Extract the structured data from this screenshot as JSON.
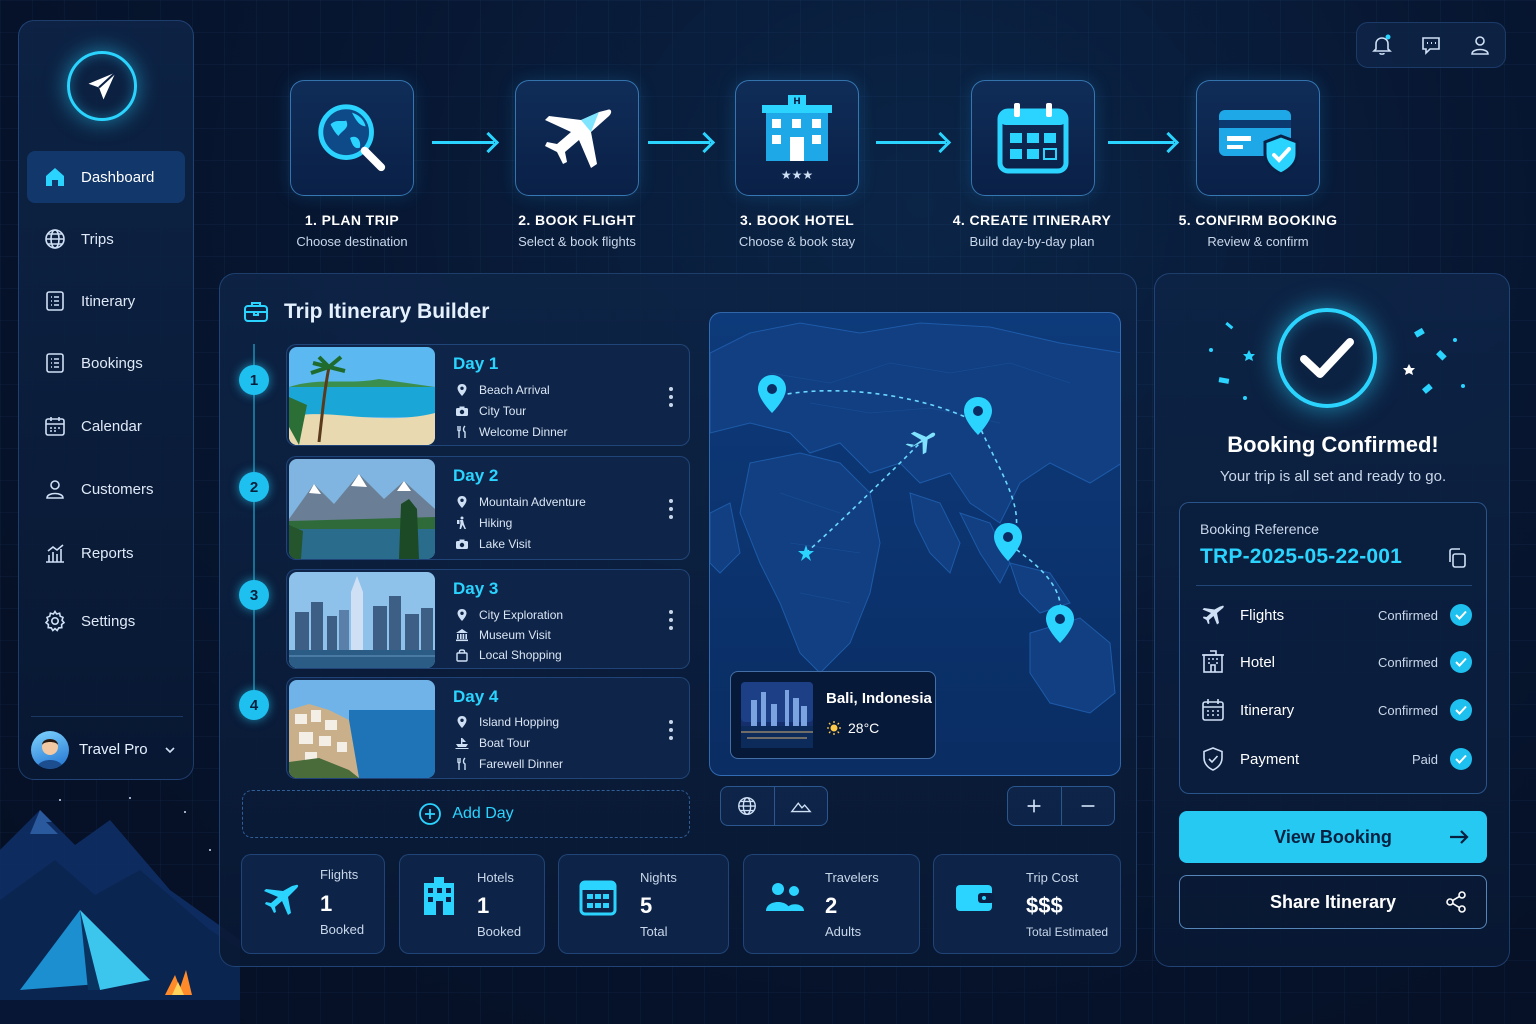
{
  "sidebar": {
    "items": [
      {
        "label": "Dashboard",
        "icon": "home-icon",
        "active": true
      },
      {
        "label": "Trips",
        "icon": "globe-icon"
      },
      {
        "label": "Itinerary",
        "icon": "list-icon"
      },
      {
        "label": "Bookings",
        "icon": "list-icon"
      },
      {
        "label": "Calendar",
        "icon": "calendar-icon"
      },
      {
        "label": "Customers",
        "icon": "user-icon"
      },
      {
        "label": "Reports",
        "icon": "chart-icon"
      },
      {
        "label": "Settings",
        "icon": "gear-icon"
      }
    ],
    "user": {
      "name": "Travel Pro"
    }
  },
  "header": {
    "icons": [
      "bell-icon",
      "chat-icon",
      "user-icon"
    ]
  },
  "steps": [
    {
      "title": "1. PLAN TRIP",
      "sub": "Choose destination",
      "icon": "globe-search-icon"
    },
    {
      "title": "2. BOOK FLIGHT",
      "sub": "Select & book flights",
      "icon": "airplane-icon"
    },
    {
      "title": "3. BOOK HOTEL",
      "sub": "Choose & book stay",
      "icon": "hotel-icon"
    },
    {
      "title": "4. CREATE ITINERARY",
      "sub": "Build day-by-day plan",
      "icon": "calendar-icon"
    },
    {
      "title": "5. CONFIRM BOOKING",
      "sub": "Review & confirm",
      "icon": "credit-card-shield-icon"
    }
  ],
  "builder": {
    "title": "Trip Itinerary Builder",
    "days": [
      {
        "num": "1",
        "title": "Day 1",
        "scene": "beach",
        "activities": [
          {
            "icon": "pin-icon",
            "text": "Beach Arrival"
          },
          {
            "icon": "camera-icon",
            "text": "City Tour"
          },
          {
            "icon": "utensils-icon",
            "text": "Welcome Dinner"
          }
        ]
      },
      {
        "num": "2",
        "title": "Day 2",
        "scene": "mountain",
        "activities": [
          {
            "icon": "pin-icon",
            "text": "Mountain Adventure"
          },
          {
            "icon": "hiking-icon",
            "text": "Hiking"
          },
          {
            "icon": "camera-icon",
            "text": "Lake Visit"
          }
        ]
      },
      {
        "num": "3",
        "title": "Day 3",
        "scene": "city",
        "activities": [
          {
            "icon": "pin-icon",
            "text": "City Exploration"
          },
          {
            "icon": "museum-icon",
            "text": "Museum Visit"
          },
          {
            "icon": "shopping-bag-icon",
            "text": "Local Shopping"
          }
        ]
      },
      {
        "num": "4",
        "title": "Day 4",
        "scene": "coast",
        "activities": [
          {
            "icon": "pin-icon",
            "text": "Island Hopping"
          },
          {
            "icon": "boat-icon",
            "text": "Boat Tour"
          },
          {
            "icon": "utensils-icon",
            "text": "Farewell Dinner"
          }
        ]
      }
    ],
    "add_day": "Add Day",
    "map": {
      "location": "Bali, Indonesia",
      "temperature": "28°C"
    },
    "stats": [
      {
        "label": "Flights",
        "value": "1",
        "sub": "Booked",
        "icon": "airplane-icon"
      },
      {
        "label": "Hotels",
        "value": "1",
        "sub": "Booked",
        "icon": "hotel-icon"
      },
      {
        "label": "Nights",
        "value": "5",
        "sub": "Total",
        "icon": "calendar-icon"
      },
      {
        "label": "Travelers",
        "value": "2",
        "sub": "Adults",
        "icon": "users-icon"
      },
      {
        "label": "Trip Cost",
        "value": "$$$",
        "sub": "Total Estimated",
        "icon": "wallet-icon"
      }
    ]
  },
  "confirmation": {
    "title": "Booking Confirmed!",
    "subtitle": "Your trip is all set and ready to go.",
    "reference_label": "Booking Reference",
    "reference": "TRP-2025-05-22-001",
    "rows": [
      {
        "name": "Flights",
        "status": "Confirmed",
        "icon": "airplane-icon"
      },
      {
        "name": "Hotel",
        "status": "Confirmed",
        "icon": "hotel-icon"
      },
      {
        "name": "Itinerary",
        "status": "Confirmed",
        "icon": "calendar-icon"
      },
      {
        "name": "Payment",
        "status": "Paid",
        "icon": "shield-check-icon"
      }
    ],
    "view_button": "View Booking",
    "share_button": "Share Itinerary"
  },
  "colors": {
    "accent": "#2ad4ff",
    "background": "#071631",
    "panel": "#0e2446",
    "button": "#25c9f2"
  }
}
